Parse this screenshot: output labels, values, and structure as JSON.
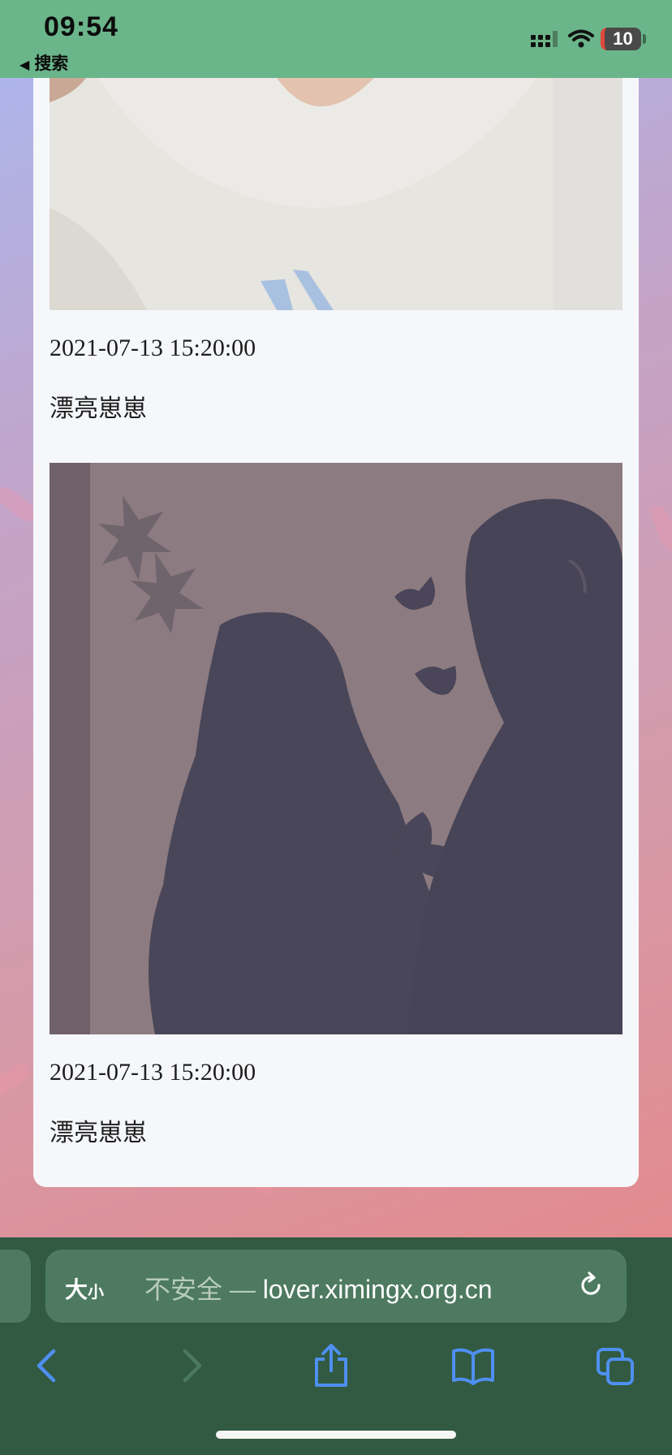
{
  "status_bar": {
    "time": "09:54",
    "back_label": "搜索",
    "battery": "10"
  },
  "posts": [
    {
      "time": "2021-07-13 15:20:00",
      "caption": "漂亮崽崽"
    },
    {
      "time": "2021-07-13 15:20:00",
      "caption": "漂亮崽崽"
    }
  ],
  "browser": {
    "text_size_big": "大",
    "text_size_small": "小",
    "security_label": "不安全 — ",
    "domain": "lover.ximingx.org.cn"
  },
  "colors": {
    "status_bar": "#6bb58a",
    "chrome": "#325a42",
    "accent": "#4f8ff0"
  }
}
